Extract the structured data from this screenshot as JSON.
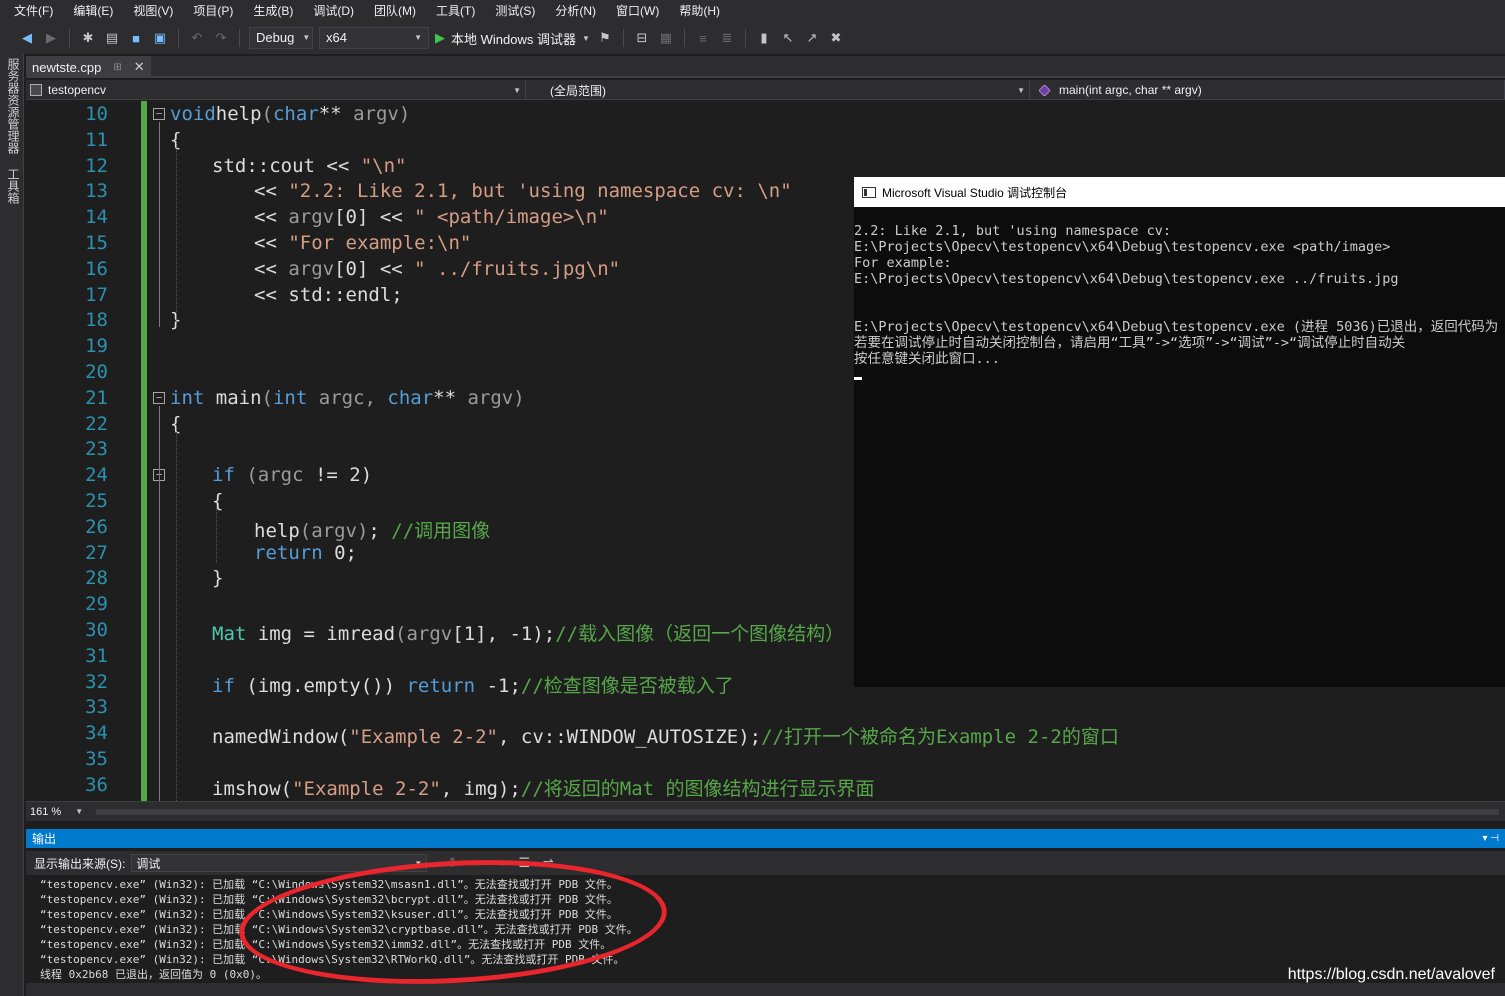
{
  "menubar": {
    "items": [
      "文件(F)",
      "编辑(E)",
      "视图(V)",
      "项目(P)",
      "生成(B)",
      "调试(D)",
      "团队(M)",
      "工具(T)",
      "测试(S)",
      "分析(N)",
      "窗口(W)",
      "帮助(H)"
    ]
  },
  "toolbar": {
    "config": "Debug",
    "platform": "x64",
    "run_label": "本地 Windows 调试器"
  },
  "leftstrip": {
    "tabs": [
      "服务器资源管理器",
      "工具箱"
    ]
  },
  "doctab": {
    "filename": "newtste.cpp",
    "pin": "⊞",
    "close": "✕"
  },
  "navbar": {
    "project": "testopencv",
    "scope": "(全局范围)",
    "member": "main(int argc, char ** argv)"
  },
  "editor": {
    "line_numbers": [
      "10",
      "11",
      "12",
      "13",
      "14",
      "15",
      "16",
      "17",
      "18",
      "19",
      "20",
      "21",
      "22",
      "23",
      "24",
      "25",
      "26",
      "27",
      "28",
      "29",
      "30",
      "31",
      "32",
      "33",
      "34",
      "35",
      "36"
    ],
    "lines": {
      "l10": [
        [
          "kw",
          "void"
        ],
        [
          "",
          "help"
        ],
        [
          "par",
          "("
        ],
        [
          "kw",
          "char"
        ],
        [
          "",
          "** "
        ],
        [
          "par",
          "argv)"
        ]
      ],
      "l11": [
        [
          "",
          "{"
        ]
      ],
      "l12": [
        [
          "",
          "std::cout << "
        ],
        [
          "str",
          "\"\\n\""
        ]
      ],
      "l13": [
        [
          "",
          "<< "
        ],
        [
          "str",
          "\"2.2: Like 2.1, but 'using namespace cv: \\n\""
        ]
      ],
      "l14": [
        [
          "",
          "<< "
        ],
        [
          "par",
          "argv"
        ],
        [
          "",
          "[0] << "
        ],
        [
          "str",
          "\" <path/image>\\n\""
        ]
      ],
      "l15": [
        [
          "",
          "<< "
        ],
        [
          "str",
          "\"For example:\\n\""
        ]
      ],
      "l16": [
        [
          "",
          "<< "
        ],
        [
          "par",
          "argv"
        ],
        [
          "",
          "[0] << "
        ],
        [
          "str",
          "\" ../fruits.jpg\\n\""
        ]
      ],
      "l17": [
        [
          "",
          "<< std::endl;"
        ]
      ],
      "l18": [
        [
          "",
          "}"
        ]
      ],
      "l21": [
        [
          "kw",
          "int"
        ],
        [
          "",
          " main"
        ],
        [
          "par",
          "("
        ],
        [
          "kw",
          "int"
        ],
        [
          "par",
          " argc, "
        ],
        [
          "kw",
          "char"
        ],
        [
          "",
          "** "
        ],
        [
          "par",
          "argv)"
        ]
      ],
      "l22": [
        [
          "",
          "{"
        ]
      ],
      "l24": [
        [
          "kw",
          "if"
        ],
        [
          "",
          " "
        ],
        [
          "par",
          "(argc"
        ],
        [
          "",
          " != 2)"
        ]
      ],
      "l25": [
        [
          "",
          "{"
        ]
      ],
      "l26": [
        [
          "",
          "help"
        ],
        [
          "par",
          "(argv)"
        ],
        [
          "",
          "; "
        ],
        [
          "cmt",
          "//调用图像"
        ]
      ],
      "l27": [
        [
          "kw",
          "return"
        ],
        [
          "",
          " 0;"
        ]
      ],
      "l28": [
        [
          "",
          "}"
        ]
      ],
      "l30": [
        [
          "ty",
          "Mat"
        ],
        [
          "",
          " img = imread"
        ],
        [
          "par",
          "(argv"
        ],
        [
          "",
          "[1], -1);"
        ],
        [
          "cmt",
          "//载入图像（返回一个图像结构）"
        ]
      ],
      "l32": [
        [
          "kw",
          "if"
        ],
        [
          "",
          " (img.empty()) "
        ],
        [
          "kw",
          "return"
        ],
        [
          "",
          " -1;"
        ],
        [
          "cmt",
          "//检查图像是否被载入了"
        ]
      ],
      "l34": [
        [
          "",
          "namedWindow("
        ],
        [
          "str",
          "\"Example 2-2\""
        ],
        [
          "",
          ", cv::WINDOW_AUTOSIZE);"
        ],
        [
          "cmt",
          "//打开一个被命名为Example 2-2的窗口"
        ]
      ],
      "l36": [
        [
          "",
          "imshow("
        ],
        [
          "str",
          "\"Example 2-2\""
        ],
        [
          "",
          ", img);"
        ],
        [
          "cmt",
          "//将返回的Mat 的图像结构进行显示界面"
        ]
      ]
    }
  },
  "zoom": "161 %",
  "output": {
    "title": "输出",
    "source_label": "显示输出来源(S):",
    "source_value": "调试",
    "lines": [
      "“testopencv.exe” (Win32): 已加载 “C:\\Windows\\System32\\msasn1.dll”。无法查找或打开 PDB 文件。",
      "“testopencv.exe” (Win32): 已加载 “C:\\Windows\\System32\\bcrypt.dll”。无法查找或打开 PDB 文件。",
      "“testopencv.exe” (Win32): 已加载 “C:\\Windows\\System32\\ksuser.dll”。无法查找或打开 PDB 文件。",
      "“testopencv.exe” (Win32): 已加载 “C:\\Windows\\System32\\cryptbase.dll”。无法查找或打开 PDB 文件。",
      "“testopencv.exe” (Win32): 已加载 “C:\\Windows\\System32\\imm32.dll”。无法查找或打开 PDB 文件。",
      "“testopencv.exe” (Win32): 已加载 “C:\\Windows\\System32\\RTWorkQ.dll”。无法查找或打开 PDB 文件。",
      "线程 0x2b68 已退出，返回值为 0 (0x0)。"
    ]
  },
  "console": {
    "title": "Microsoft Visual Studio 调试控制台",
    "lines": [
      "2.2: Like 2.1, but 'using namespace cv:",
      "E:\\Projects\\Opecv\\testopencv\\x64\\Debug\\testopencv.exe <path/image>",
      "For example:",
      "E:\\Projects\\Opecv\\testopencv\\x64\\Debug\\testopencv.exe ../fruits.jpg",
      "",
      "",
      "E:\\Projects\\Opecv\\testopencv\\x64\\Debug\\testopencv.exe (进程 5036)已退出，返回代码为",
      "若要在调试停止时自动关闭控制台，请启用“工具”->“选项”->“调试”->“调试停止时自动关",
      "按任意键关闭此窗口..."
    ]
  },
  "watermark": "https://blog.csdn.net/avalovef"
}
